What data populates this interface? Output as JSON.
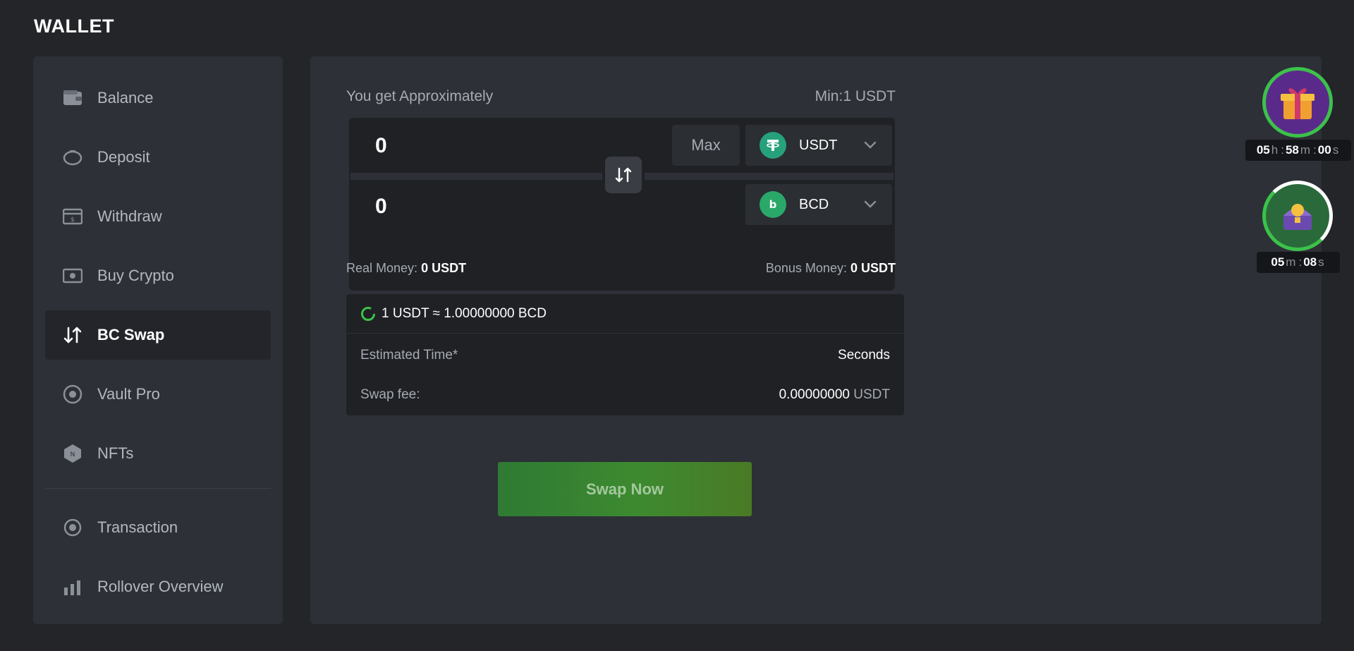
{
  "page": {
    "title": "WALLET"
  },
  "sidebar": {
    "items": [
      {
        "label": "Balance",
        "icon": "wallet-icon"
      },
      {
        "label": "Deposit",
        "icon": "piggy-bank-icon"
      },
      {
        "label": "Withdraw",
        "icon": "withdraw-icon"
      },
      {
        "label": "Buy Crypto",
        "icon": "cash-icon"
      },
      {
        "label": "BC Swap",
        "icon": "swap-icon",
        "active": true
      },
      {
        "label": "Vault Pro",
        "icon": "vault-icon"
      },
      {
        "label": "NFTs",
        "icon": "nft-icon"
      },
      {
        "label": "Transaction",
        "icon": "transaction-icon"
      },
      {
        "label": "Rollover Overview",
        "icon": "chart-bars-icon"
      }
    ]
  },
  "swap": {
    "get_label": "You get Approximately",
    "min_label": "Min:1 USDT",
    "from_amount": "0",
    "to_amount": "0",
    "max_label": "Max",
    "from_coin": "USDT",
    "to_coin": "BCD",
    "real_money_label": "Real Money:",
    "real_money_value": "0 USDT",
    "bonus_money_label": "Bonus Money:",
    "bonus_money_value": "0 USDT",
    "rate": "1 USDT ≈ 1.00000000 BCD",
    "estimated_time_label": "Estimated Time*",
    "estimated_time_value": "Seconds",
    "fee_label": "Swap fee:",
    "fee_value": "0.00000000",
    "fee_unit": "USDT",
    "button_label": "Swap Now"
  },
  "rewards": {
    "gift_timer": {
      "h": "05",
      "h_unit": "h",
      "sep": ":",
      "m": "58",
      "m_unit": "m",
      "s": "00",
      "s_unit": "s"
    },
    "chest_timer": {
      "m": "05",
      "m_unit": "m",
      "sep": ":",
      "s": "08",
      "s_unit": "s"
    }
  },
  "colors": {
    "accent_green": "#3d8a30",
    "usdt": "#26a17b",
    "bcd": "#2aa86a"
  }
}
